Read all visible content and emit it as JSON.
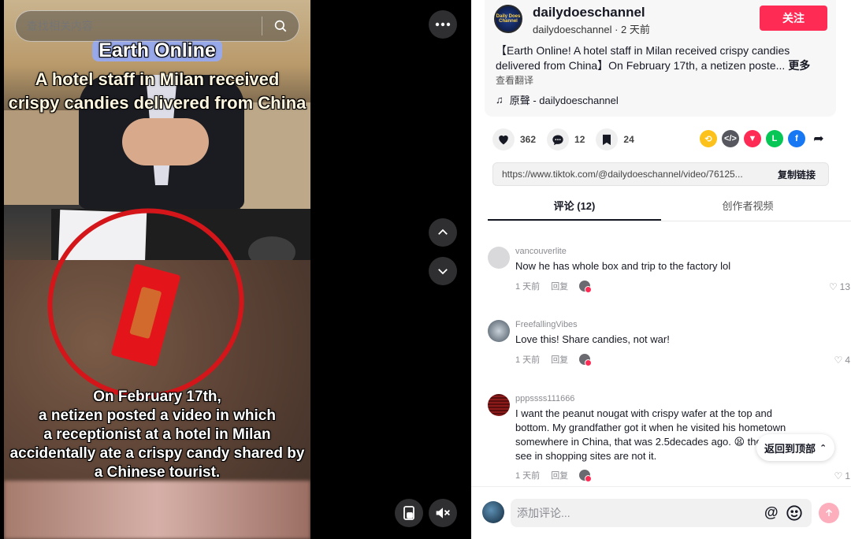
{
  "search": {
    "placeholder": "查找相关内容"
  },
  "video": {
    "caption_title": "Earth Online",
    "caption_sub_1": "A hotel staff in Milan received",
    "caption_sub_2": "crispy candies delivered from China",
    "caption_bottom": [
      "On February 17th,",
      "a netizen posted a video in which",
      "a receptionist at a hotel in Milan",
      "accidentally ate a crispy candy shared by",
      "a Chinese tourist."
    ]
  },
  "author": {
    "avatar_text": "Daily Does Channel",
    "name": "dailydoeschannel",
    "sub": "dailydoeschannel · 2 天前",
    "follow_label": "关注"
  },
  "post": {
    "description": "【Earth Online! A hotel staff in Milan received crispy candies delivered from China】On February 17th, a netizen poste...",
    "more_label": "更多",
    "translate_label": "查看翻译",
    "sound": "原聲 - dailydoeschannel"
  },
  "stats": {
    "likes": "362",
    "comments": "12",
    "saves": "24"
  },
  "link": {
    "url": "https://www.tiktok.com/@dailydoeschannel/video/76125...",
    "copy_label": "复制链接"
  },
  "tabs": [
    {
      "label": "评论 (12)"
    },
    {
      "label": "创作者视频"
    }
  ],
  "comments": [
    {
      "user": "vancouverlite",
      "text": "Now he has whole box and trip to the factory lol",
      "time": "1 天前",
      "reply": "回复",
      "likes": "13",
      "avatar_color": "#d9d9db"
    },
    {
      "user": "FreefallingVibes",
      "text": "Love this! Share candies, not war!",
      "time": "1 天前",
      "reply": "回复",
      "likes": "4",
      "avatar_color": "#8a939c"
    },
    {
      "user": "pppssss111666",
      "text": "I want the peanut nougat with crispy wafer at the top and bottom. My grandfather got it when he visited his hometown somewhere in China, that was 2.5decades ago. 😫 the ones I see in shopping sites are not it.",
      "time": "1 天前",
      "reply": "回复",
      "likes": "1",
      "avatar_color": "#8b1a1a"
    }
  ],
  "back_to_top": "返回到顶部",
  "composer": {
    "placeholder": "添加评论..."
  },
  "colors": {
    "accent": "#fe2c55"
  }
}
